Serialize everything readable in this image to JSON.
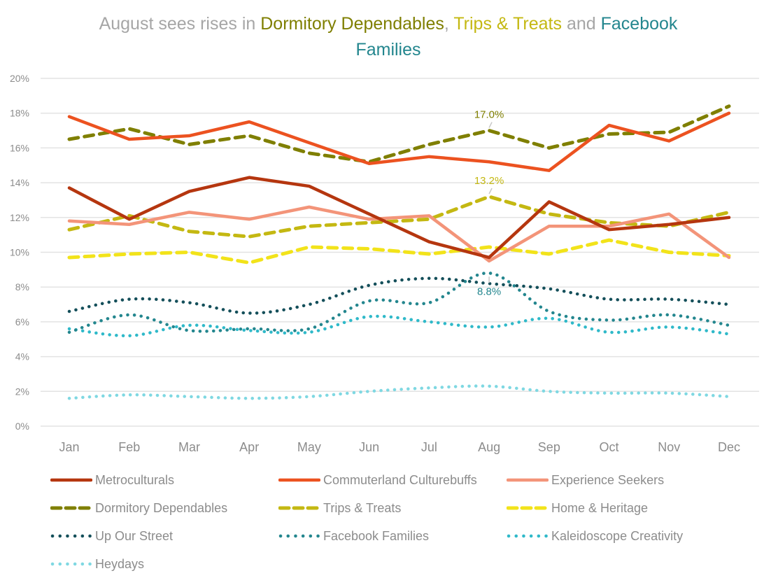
{
  "title": {
    "parts": [
      {
        "text": "August sees rises in ",
        "color": "#a6a6a6"
      },
      {
        "text": "Dormitory Dependables",
        "color": "#7f7f00"
      },
      {
        "text": ", ",
        "color": "#a6a6a6"
      },
      {
        "text": "Trips & Treats",
        "color": "#c4b812"
      },
      {
        "text": " and ",
        "color": "#a6a6a6"
      },
      {
        "text": "Facebook Families",
        "color": "#23868e"
      }
    ]
  },
  "chart_data": {
    "type": "line",
    "title": "August sees rises in Dormitory Dependables, Trips & Treats and Facebook Families",
    "xlabel": "",
    "ylabel": "",
    "x": [
      "Jan",
      "Feb",
      "Mar",
      "Apr",
      "May",
      "Jun",
      "Jul",
      "Aug",
      "Sep",
      "Oct",
      "Nov",
      "Dec"
    ],
    "ylim": [
      0,
      20
    ],
    "yticks": [
      0,
      2,
      4,
      6,
      8,
      10,
      12,
      14,
      16,
      18,
      20
    ],
    "ytick_labels": [
      "0%",
      "2%",
      "4%",
      "6%",
      "8%",
      "10%",
      "12%",
      "14%",
      "16%",
      "18%",
      "20%"
    ],
    "grid": true,
    "legend_position": "bottom",
    "series": [
      {
        "name": "Metroculturals",
        "color": "#b5360f",
        "style": "solid",
        "values": [
          13.7,
          11.9,
          13.5,
          14.3,
          13.8,
          12.2,
          10.6,
          9.7,
          12.9,
          11.3,
          11.6,
          12.0
        ]
      },
      {
        "name": "Commuterland Culturebuffs",
        "color": "#ec5220",
        "style": "solid",
        "values": [
          17.8,
          16.5,
          16.7,
          17.5,
          16.3,
          15.1,
          15.5,
          15.2,
          14.7,
          17.3,
          16.4,
          18.0
        ]
      },
      {
        "name": "Experience Seekers",
        "color": "#f39479",
        "style": "solid",
        "values": [
          11.8,
          11.6,
          12.3,
          11.9,
          12.6,
          11.9,
          12.1,
          9.5,
          11.5,
          11.5,
          12.2,
          9.7
        ]
      },
      {
        "name": "Dormitory Dependables",
        "color": "#7f7f00",
        "style": "dashed",
        "values": [
          16.5,
          17.1,
          16.2,
          16.7,
          15.7,
          15.2,
          16.2,
          17.0,
          16.0,
          16.8,
          16.9,
          18.4
        ]
      },
      {
        "name": "Trips & Treats",
        "color": "#c4b812",
        "style": "dashed",
        "values": [
          11.3,
          12.1,
          11.2,
          10.9,
          11.5,
          11.7,
          11.9,
          13.2,
          12.2,
          11.7,
          11.5,
          12.3
        ]
      },
      {
        "name": "Home & Heritage",
        "color": "#f2e31a",
        "style": "dashed",
        "values": [
          9.7,
          9.9,
          10.0,
          9.4,
          10.3,
          10.2,
          9.9,
          10.3,
          9.9,
          10.7,
          10.0,
          9.8
        ]
      },
      {
        "name": "Up Our Street",
        "color": "#144f5a",
        "style": "dotted",
        "values": [
          6.6,
          7.3,
          7.1,
          6.5,
          7.0,
          8.1,
          8.5,
          8.2,
          7.9,
          7.3,
          7.3,
          7.0
        ]
      },
      {
        "name": "Facebook Families",
        "color": "#23868e",
        "style": "dotted",
        "values": [
          5.4,
          6.4,
          5.5,
          5.6,
          5.6,
          7.2,
          7.1,
          8.8,
          6.6,
          6.1,
          6.4,
          5.8
        ]
      },
      {
        "name": "Kaleidoscope Creativity",
        "color": "#2fb9c9",
        "style": "dotted",
        "values": [
          5.6,
          5.2,
          5.8,
          5.5,
          5.4,
          6.3,
          6.0,
          5.7,
          6.2,
          5.4,
          5.7,
          5.3
        ]
      },
      {
        "name": "Heydays",
        "color": "#7fd8e2",
        "style": "dotted",
        "values": [
          1.6,
          1.8,
          1.7,
          1.6,
          1.7,
          2.0,
          2.2,
          2.3,
          2.0,
          1.9,
          1.9,
          1.7
        ]
      }
    ],
    "annotations": [
      {
        "series": "Dormitory Dependables",
        "x": "Aug",
        "value": 17.0,
        "label": "17.0%",
        "position": "above"
      },
      {
        "series": "Trips & Treats",
        "x": "Aug",
        "value": 13.2,
        "label": "13.2%",
        "position": "above"
      },
      {
        "series": "Facebook Families",
        "x": "Aug",
        "value": 8.8,
        "label": "8.8%",
        "position": "below"
      }
    ]
  }
}
